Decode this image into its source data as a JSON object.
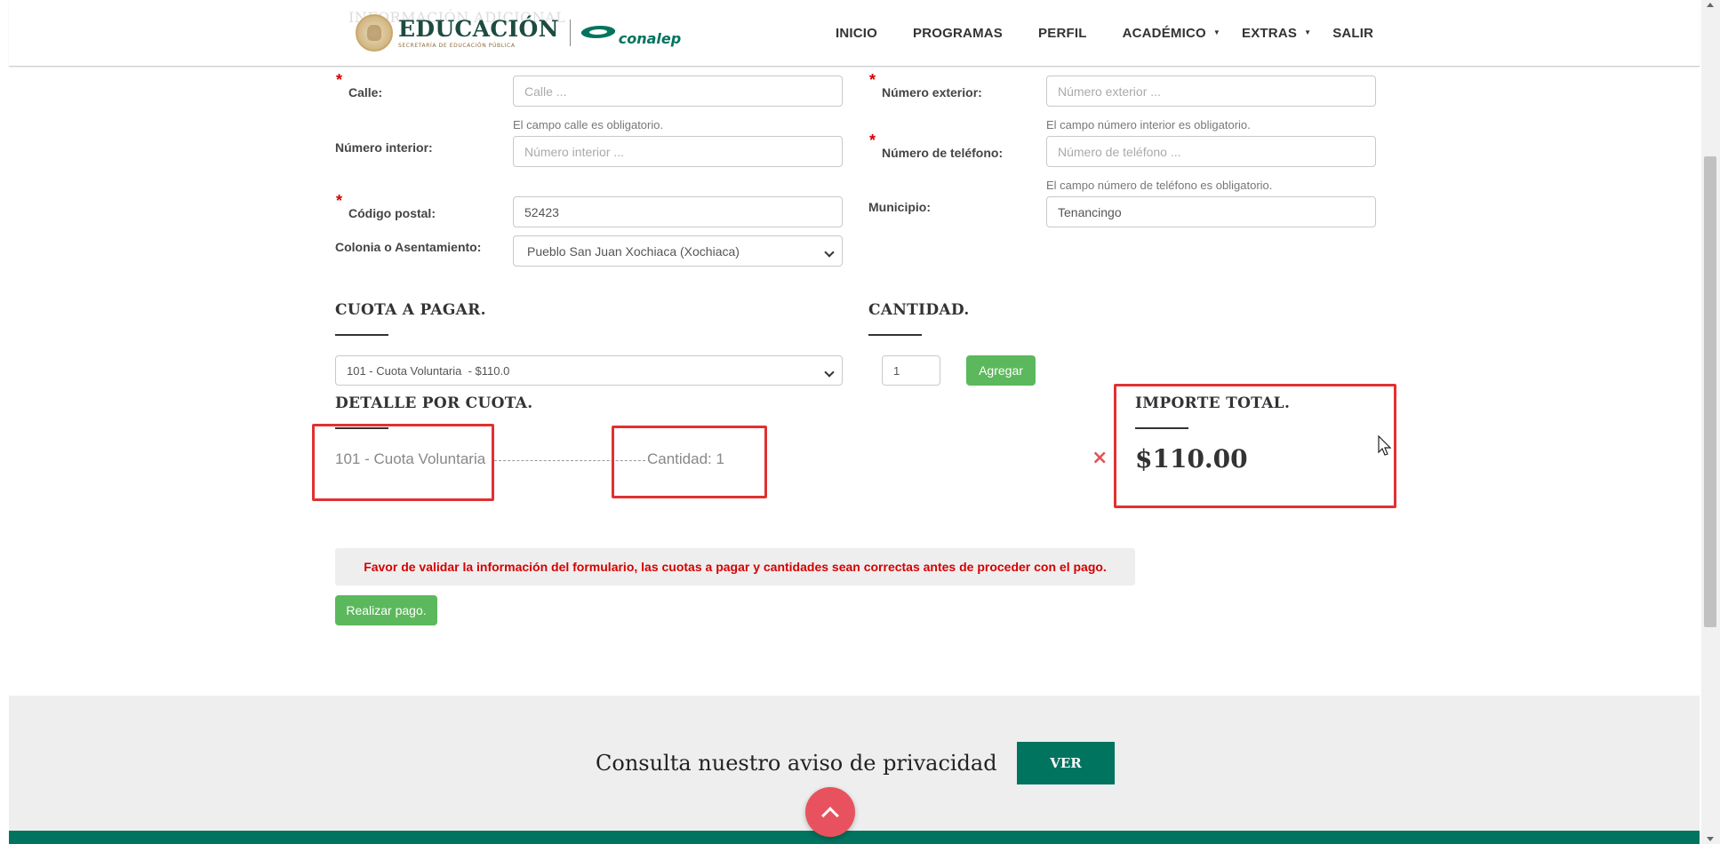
{
  "header": {
    "ghost_title": "INFORMACIÓN ADICIONAL",
    "logo": {
      "main": "EDUCACIÓN",
      "sub": "SECRETARÍA DE EDUCACIÓN PÚBLICA",
      "brand": "conalep"
    },
    "nav": [
      {
        "label": "INICIO",
        "dropdown": false
      },
      {
        "label": "PROGRAMAS",
        "dropdown": false
      },
      {
        "label": "PERFIL",
        "dropdown": false
      },
      {
        "label": "ACADÉMICO",
        "dropdown": true
      },
      {
        "label": "EXTRAS",
        "dropdown": true
      },
      {
        "label": "SALIR",
        "dropdown": false
      }
    ]
  },
  "form": {
    "calle": {
      "label": "Calle:",
      "placeholder": "Calle ...",
      "value": "",
      "help": "El campo calle es obligatorio."
    },
    "numero_exterior": {
      "label": "Número exterior:",
      "placeholder": "Número exterior ...",
      "value": "",
      "help": "El campo número interior es obligatorio."
    },
    "numero_interior": {
      "label": "Número interior:",
      "placeholder": "Número interior ...",
      "value": ""
    },
    "telefono": {
      "label": "Número de teléfono:",
      "placeholder": "Número de teléfono ...",
      "value": "",
      "help": "El campo número de teléfono es obligatorio."
    },
    "codigo_postal": {
      "label": "Código postal:",
      "value": "52423"
    },
    "municipio": {
      "label": "Municipio:",
      "value": "Tenancingo"
    },
    "colonia": {
      "label": "Colonia o Asentamiento:",
      "value": "Pueblo San Juan Xochiaca (Xochiaca)"
    },
    "required_mark": "*"
  },
  "cuota": {
    "heading": "CUOTA A PAGAR.",
    "selected": "101 - Cuota Voluntaria  - $110.0",
    "cantidad_heading": "CANTIDAD.",
    "cantidad_value": "1",
    "add_label": "Agregar"
  },
  "detalle": {
    "heading": "DETALLE POR CUOTA.",
    "item_name": "101 - Cuota Voluntaria",
    "item_qty": "Cantidad: 1",
    "remove_icon": "×"
  },
  "importe": {
    "heading": "IMPORTE TOTAL.",
    "total": "$110.00"
  },
  "alert": {
    "text": "Favor de validar la información del formulario, las cuotas a pagar y cantidades sean correctas antes de proceder con el pago.",
    "color": "#d60000"
  },
  "pay_button": "Realizar pago.",
  "footer": {
    "privacy_text": "Consulta nuestro aviso de privacidad",
    "ver_label": "VER"
  },
  "colors": {
    "brand_green": "#00745f",
    "button_green": "#5cb85c",
    "highlight_red": "#e03131",
    "up_button": "#e8525e"
  }
}
